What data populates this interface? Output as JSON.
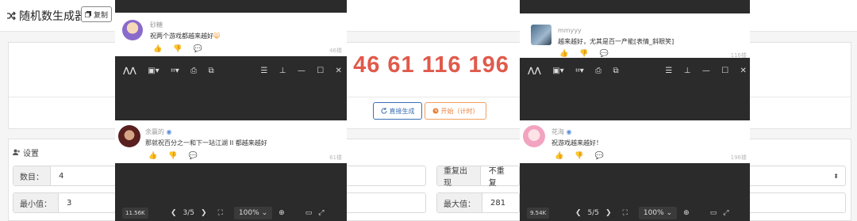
{
  "app": {
    "title": "随机数生成器",
    "copy_label": "复制"
  },
  "result_numbers": "46 61 116 196",
  "buttons": {
    "direct": "直接生成",
    "start": "开始（计时）"
  },
  "settings": {
    "title": "设置",
    "count_label": "数目：",
    "count_value": "4",
    "min_label": "最小值：",
    "min_value": "3",
    "repeat_label": "重复出现",
    "repeat_value": "不重复",
    "max_label": "最大值：",
    "max_value": "281"
  },
  "left_viewer": {
    "top_comment": {
      "user": "砂糖",
      "text": "祝两个游戏都越来越好",
      "floor": "46楼"
    },
    "comment": {
      "user": "余赢的",
      "text": "那就祝百分之一和下一站江湖 II 都越来越好",
      "floor": "61楼"
    },
    "badge": "11.56K",
    "page": "3/5",
    "zoom": "100%"
  },
  "right_viewer": {
    "top_comment": {
      "user": "mmyyy",
      "text": "越来越好，尤其是百一产能[表情_斜眼笑]",
      "floor": "116楼"
    },
    "comment": {
      "user": "花海",
      "text": "祝游戏越来越好！",
      "floor": "196楼"
    },
    "badge": "9.54K",
    "page": "5/5",
    "zoom": "100%"
  },
  "colors": {
    "number_red": "#e05a4b",
    "viewer_dark": "#2b2b2b",
    "primary_blue": "#3b6fb6",
    "start_orange": "#e8803a"
  }
}
